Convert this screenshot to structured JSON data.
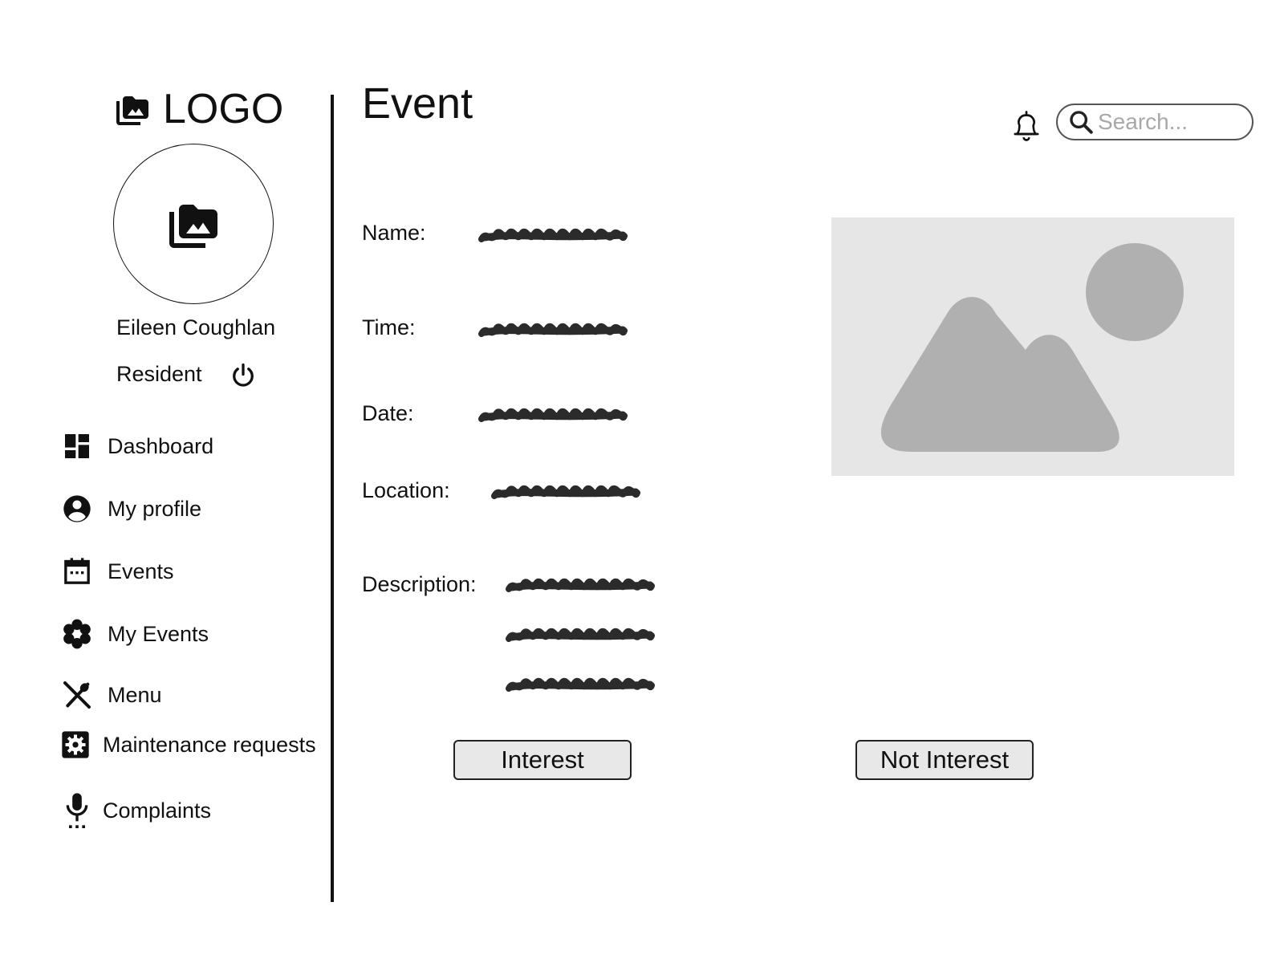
{
  "sidebar": {
    "logo": {
      "icon": "photo-library-icon",
      "text": "LOGO"
    },
    "user": {
      "name": "Eileen Coughlan",
      "role": "Resident",
      "avatar_icon": "photo-library-icon"
    },
    "logout_icon": "power-icon",
    "nav": [
      {
        "label": "Dashboard",
        "icon": "dashboard-icon"
      },
      {
        "label": "My profile",
        "icon": "account-circle-icon"
      },
      {
        "label": "Events",
        "icon": "calendar-icon"
      },
      {
        "label": "My Events",
        "icon": "flower-icon"
      },
      {
        "label": "Menu",
        "icon": "utensils-icon"
      },
      {
        "label": "Maintenance requests",
        "icon": "settings-gear-icon"
      },
      {
        "label": "Complaints",
        "icon": "microphone-icon"
      }
    ]
  },
  "header": {
    "title": "Event",
    "notification_icon": "bell-icon",
    "search": {
      "placeholder": "Search...",
      "value": "",
      "icon": "search-icon"
    }
  },
  "event": {
    "fields": [
      {
        "label": "Name:"
      },
      {
        "label": "Time:"
      },
      {
        "label": "Date:"
      },
      {
        "label": "Location:"
      },
      {
        "label": "Description:"
      }
    ],
    "image": {
      "icon": "image-placeholder-icon"
    }
  },
  "actions": {
    "interest": "Interest",
    "not_interest": "Not Interest"
  },
  "colors": {
    "text": "#111111",
    "placeholder_bg": "#e6e6e6",
    "placeholder_shape": "#b0b0b0",
    "button_bg": "#e8e8e8",
    "scribble": "#2b2b2b"
  }
}
